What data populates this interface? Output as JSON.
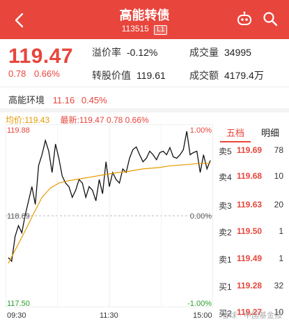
{
  "header": {
    "back_icon": "back-chevron-icon",
    "title": "高能转债",
    "code": "113515",
    "tag": "L1",
    "robot_icon": "robot-assistant-icon",
    "search_icon": "search-icon"
  },
  "quote": {
    "price": "119.47",
    "change": "0.78",
    "change_pct": "0.66%",
    "premium_label": "溢价率",
    "premium_value": "-0.12%",
    "volume_label": "成交量",
    "volume_value": "34995",
    "conv_label": "转股价值",
    "conv_value": "119.61",
    "turnover_label": "成交额",
    "turnover_value": "4179.4万"
  },
  "env": {
    "label": "高能环境",
    "price": "11.16",
    "pct": "0.45%"
  },
  "legend": {
    "avg": "均价:119.43",
    "latest": "最新:119.47  0.78  0.66%"
  },
  "chart_axes": {
    "y_top": "119.88",
    "y_mid": "118.69",
    "y_bottom": "117.50",
    "pct_top": "1.00%",
    "pct_mid": "0.00%",
    "pct_bottom": "-1.00%",
    "x_start": "09:30",
    "x_mid": "11:30",
    "x_end": "15:00"
  },
  "chart_data": {
    "type": "line",
    "ylim": [
      117.5,
      119.88
    ],
    "series": [
      {
        "key": "price",
        "color": "#111111",
        "x": [
          "09:30",
          "09:34",
          "09:38",
          "09:42",
          "09:46",
          "09:50",
          "09:54",
          "09:58",
          "10:02",
          "10:06",
          "10:10",
          "10:14",
          "10:18",
          "10:22",
          "10:26",
          "10:30",
          "10:34",
          "10:38",
          "10:42",
          "10:46",
          "10:50",
          "10:54",
          "10:58",
          "11:02",
          "11:06",
          "11:10",
          "11:14",
          "11:18",
          "11:22",
          "11:26",
          "11:30",
          "13:04",
          "13:08",
          "13:12",
          "13:16",
          "13:20",
          "13:24",
          "13:28",
          "13:32",
          "13:36",
          "13:40",
          "13:44",
          "13:48",
          "13:52",
          "13:56",
          "14:00",
          "14:04",
          "14:08",
          "14:12",
          "14:16",
          "14:20",
          "14:24",
          "14:28",
          "14:32",
          "14:36",
          "14:40",
          "14:44",
          "14:48",
          "14:52",
          "14:56",
          "15:00"
        ],
        "values": [
          118.1,
          118.05,
          118.4,
          118.55,
          118.45,
          118.7,
          118.9,
          119.1,
          118.85,
          119.4,
          119.55,
          119.75,
          119.6,
          119.3,
          119.7,
          119.5,
          119.25,
          119.15,
          119.1,
          118.95,
          119.05,
          119.2,
          119.15,
          118.95,
          119.1,
          119.05,
          118.9,
          119.2,
          119.0,
          119.45,
          119.1,
          119.3,
          119.2,
          119.15,
          119.35,
          119.3,
          119.5,
          119.62,
          119.66,
          119.55,
          119.45,
          119.5,
          119.6,
          119.55,
          119.48,
          119.58,
          119.6,
          119.55,
          119.65,
          119.52,
          119.5,
          119.55,
          119.62,
          119.88,
          119.55,
          119.58,
          119.6,
          119.3,
          119.55,
          119.35,
          119.47
        ]
      },
      {
        "key": "avg",
        "color": "#e89a00",
        "x": [
          "09:30",
          "09:40",
          "09:50",
          "10:00",
          "10:10",
          "10:20",
          "10:30",
          "10:40",
          "10:50",
          "11:00",
          "11:10",
          "11:20",
          "11:30",
          "13:10",
          "13:20",
          "13:30",
          "13:40",
          "13:50",
          "14:00",
          "14:10",
          "14:20",
          "14:30",
          "14:40",
          "14:50",
          "15:00"
        ],
        "values": [
          118.02,
          118.25,
          118.48,
          118.72,
          118.95,
          119.08,
          119.15,
          119.18,
          119.2,
          119.22,
          119.24,
          119.26,
          119.28,
          119.3,
          119.31,
          119.33,
          119.35,
          119.36,
          119.37,
          119.39,
          119.4,
          119.41,
          119.42,
          119.43,
          119.43
        ]
      }
    ]
  },
  "order_book": {
    "tabs": [
      "五档",
      "明细"
    ],
    "rows": [
      {
        "label": "卖5",
        "price": "119.69",
        "qty": "78"
      },
      {
        "label": "卖4",
        "price": "119.68",
        "qty": "10"
      },
      {
        "label": "卖3",
        "price": "119.63",
        "qty": "20"
      },
      {
        "label": "卖2",
        "price": "119.50",
        "qty": "1"
      },
      {
        "label": "卖1",
        "price": "119.49",
        "qty": "1"
      },
      {
        "label": "买1",
        "price": "119.28",
        "qty": "32"
      },
      {
        "label": "买2",
        "price": "119.27",
        "qty": "10"
      }
    ]
  },
  "watermark": "雪球 · 中国基金报"
}
